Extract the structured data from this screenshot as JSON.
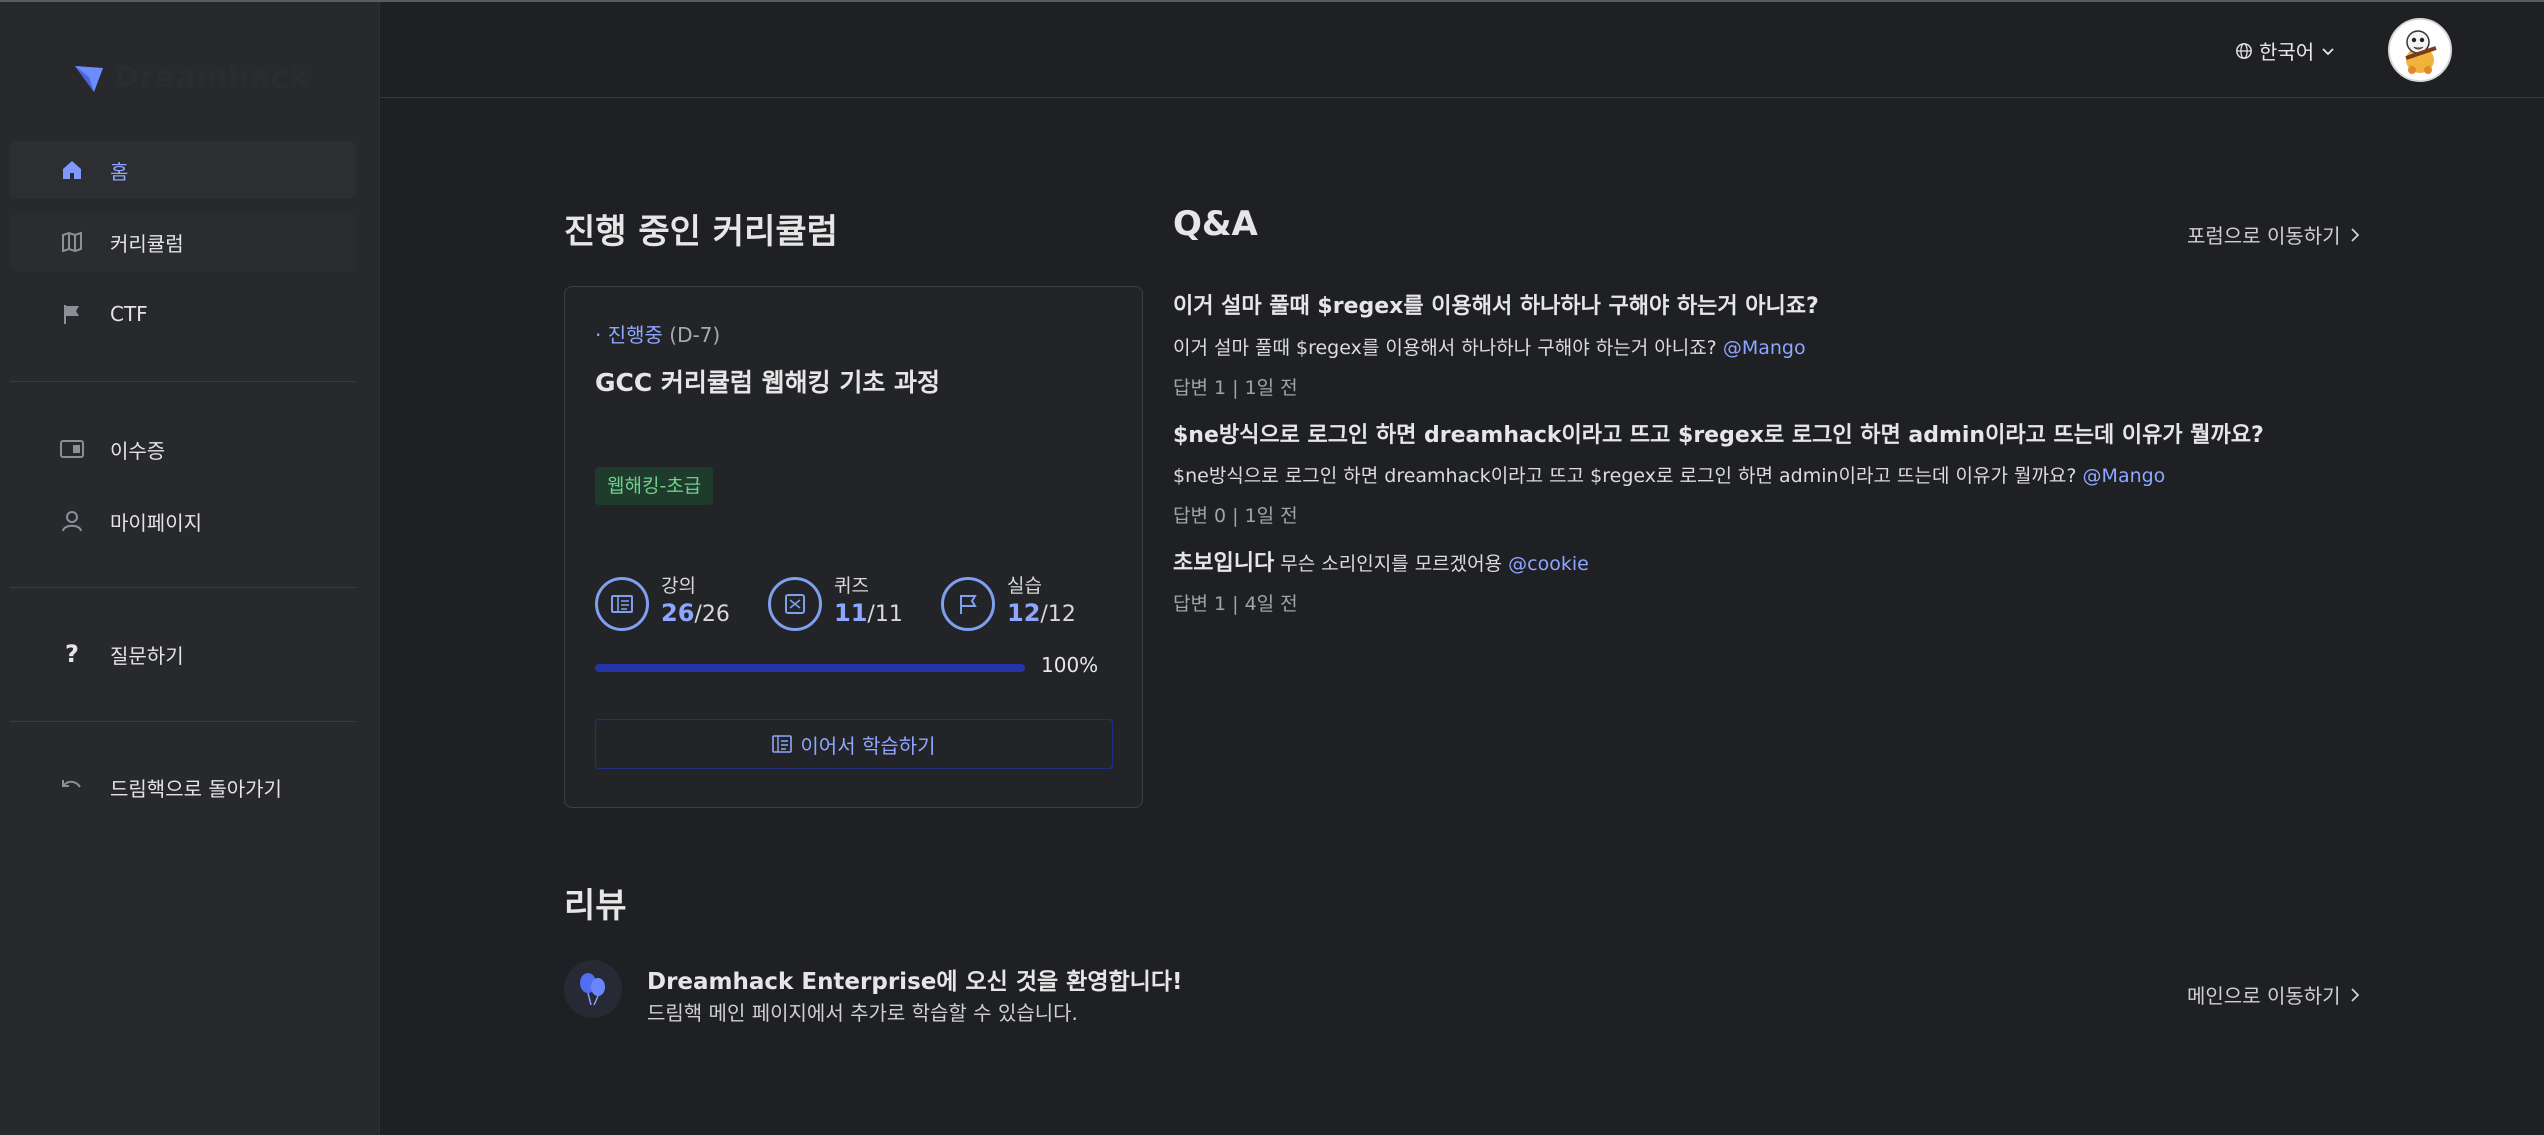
{
  "brand": {
    "name": "Dreamhack",
    "accent": "#8ea6ff"
  },
  "sidebar": {
    "items": [
      {
        "label": "홈",
        "icon": "home-icon"
      },
      {
        "label": "커리큘럼",
        "icon": "map-icon"
      },
      {
        "label": "CTF",
        "icon": "flag-icon"
      },
      {
        "label": "이수증",
        "icon": "certificate-icon"
      },
      {
        "label": "마이페이지",
        "icon": "user-icon"
      },
      {
        "label": "질문하기",
        "icon": "question-icon"
      },
      {
        "label": "드림핵으로 돌아가기",
        "icon": "undo-icon"
      }
    ]
  },
  "header": {
    "language": "한국어"
  },
  "curriculum": {
    "section_title": "진행 중인 커리큘럼",
    "status_label": "· 진행중",
    "status_deadline": "(D-7)",
    "course_title": "GCC 커리큘럼 웹해킹 기초 과정",
    "tag": "웹해킹-초급",
    "stats": [
      {
        "label": "강의",
        "done": "26",
        "total": "/26"
      },
      {
        "label": "퀴즈",
        "done": "11",
        "total": "/11"
      },
      {
        "label": "실습",
        "done": "12",
        "total": "/12"
      }
    ],
    "progress": 1.0,
    "progress_text": "100%",
    "continue_label": "이어서 학습하기"
  },
  "qa": {
    "section_title": "Q&A",
    "forum_link": "포럼으로 이동하기",
    "questions": [
      {
        "title": "이거 설마 풀때 $regex를 이용해서 하나하나 구해야 하는거 아니죠?",
        "body": "이거 설마 풀때 $regex를 이용해서 하나하나 구해야 하는거 아니죠?",
        "mention": "@Mango",
        "meta": "답변 1 | 1일 전"
      },
      {
        "title": "$ne방식으로 로그인 하면 dreamhack이라고 뜨고 $regex로 로그인 하면 admin이라고 뜨는데 이유가 뭘까요?",
        "body": "$ne방식으로 로그인 하면 dreamhack이라고 뜨고 $regex로 로그인 하면 admin이라고 뜨는데 이유가 뭘까요?",
        "mention": "@Mango",
        "meta": "답변 0 | 1일 전"
      },
      {
        "title": "초보입니다",
        "body": "무슨 소리인지를 모르겠어용",
        "mention": "@cookie",
        "meta": "답변 1 | 4일 전"
      }
    ]
  },
  "review": {
    "section_title": "리뷰",
    "title": "Dreamhack Enterprise에 오신 것을 환영합니다!",
    "subtitle": "드림핵 메인 페이지에서 추가로 학습할 수 있습니다.",
    "link": "메인으로 이동하기"
  }
}
